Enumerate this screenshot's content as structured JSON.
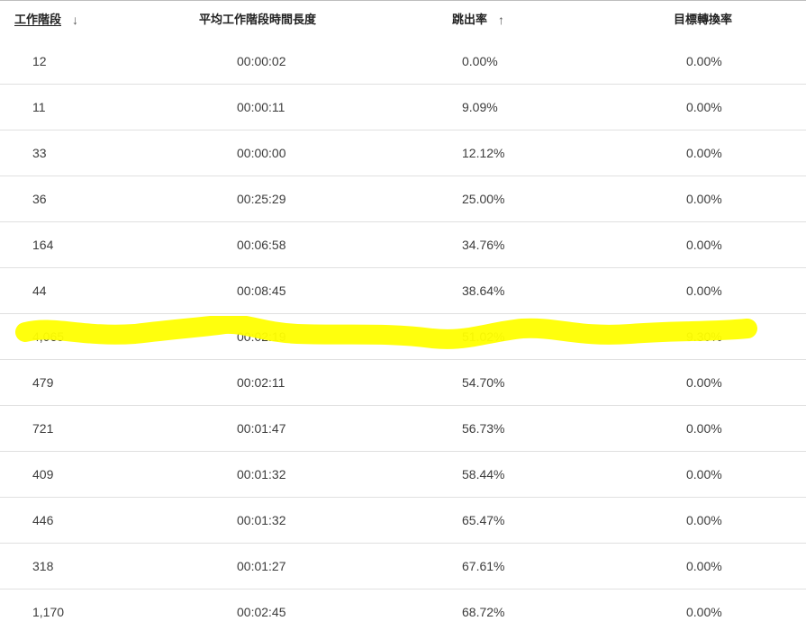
{
  "header": {
    "sessions": "工作階段",
    "avg_duration": "平均工作階段時間長度",
    "bounce_rate": "跳出率",
    "goal_conversion": "目標轉換率",
    "sessions_sort_icon": "↓",
    "bounce_sort_icon": "↑"
  },
  "rows": [
    {
      "sessions": "12",
      "duration": "00:00:02",
      "bounce": "0.00%",
      "goal": "0.00%"
    },
    {
      "sessions": "11",
      "duration": "00:00:11",
      "bounce": "9.09%",
      "goal": "0.00%"
    },
    {
      "sessions": "33",
      "duration": "00:00:00",
      "bounce": "12.12%",
      "goal": "0.00%"
    },
    {
      "sessions": "36",
      "duration": "00:25:29",
      "bounce": "25.00%",
      "goal": "0.00%"
    },
    {
      "sessions": "164",
      "duration": "00:06:58",
      "bounce": "34.76%",
      "goal": "0.00%"
    },
    {
      "sessions": "44",
      "duration": "00:08:45",
      "bounce": "38.64%",
      "goal": "0.00%"
    },
    {
      "sessions": "4,065",
      "duration": "00:02:19",
      "bounce": "51.02%",
      "goal": "9.30%"
    },
    {
      "sessions": "479",
      "duration": "00:02:11",
      "bounce": "54.70%",
      "goal": "0.00%"
    },
    {
      "sessions": "721",
      "duration": "00:01:47",
      "bounce": "56.73%",
      "goal": "0.00%"
    },
    {
      "sessions": "409",
      "duration": "00:01:32",
      "bounce": "58.44%",
      "goal": "0.00%"
    },
    {
      "sessions": "446",
      "duration": "00:01:32",
      "bounce": "65.47%",
      "goal": "0.00%"
    },
    {
      "sessions": "318",
      "duration": "00:01:27",
      "bounce": "67.61%",
      "goal": "0.00%"
    },
    {
      "sessions": "1,170",
      "duration": "00:02:45",
      "bounce": "68.72%",
      "goal": "0.00%"
    }
  ],
  "colors": {
    "highlight": "#ffff00",
    "divider": "#e0e0e0",
    "text": "#3c3c3c"
  }
}
